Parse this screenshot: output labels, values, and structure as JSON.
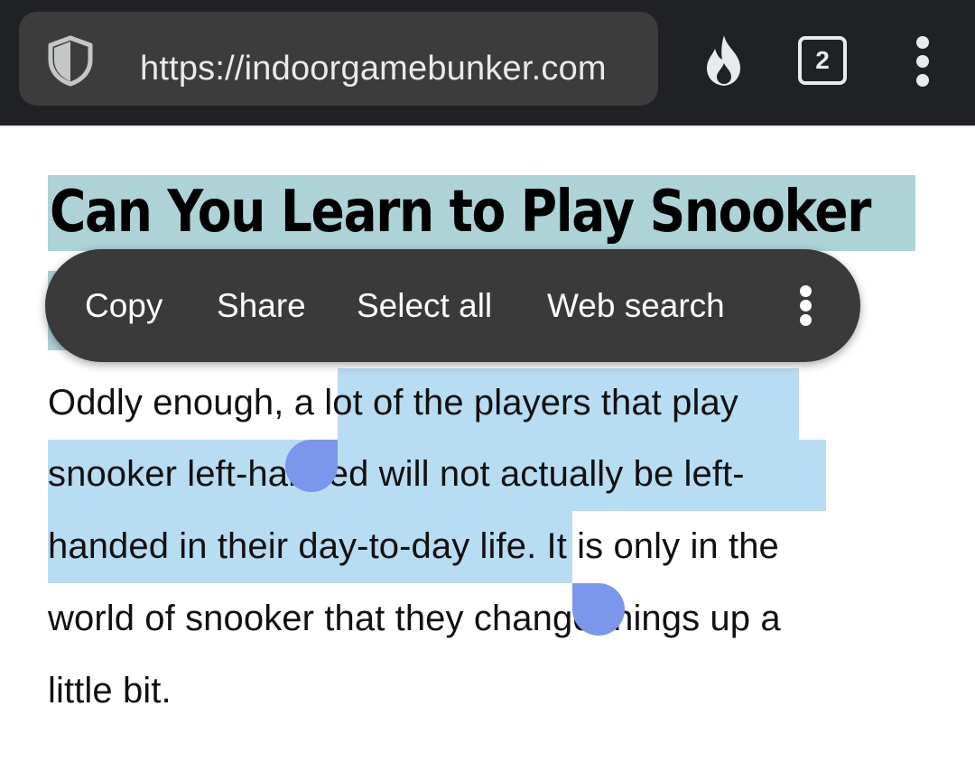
{
  "toolbar": {
    "url": "https://indoorgamebunker.com",
    "tab_count": "2",
    "icons": {
      "security": "shield-icon",
      "fire": "fire-icon",
      "menu": "more-vert-icon"
    }
  },
  "article": {
    "title_visible": "Can You Learn to Play Snooker",
    "paragraph_lines": [
      "Oddly enough, a lot of the players that play",
      "snooker left-handed will not actually be left-",
      "handed in their day-to-day life. It is only in the",
      "world of snooker that they change things up a",
      "little bit."
    ]
  },
  "context_menu": {
    "items": [
      "Copy",
      "Share",
      "Select all",
      "Web search"
    ],
    "more_icon": "more-vert-icon"
  },
  "colors": {
    "toolbar_bg": "#202124",
    "url_bar_bg": "#3c3c3c",
    "title_highlight": "#add3d7",
    "selection_highlight": "#b8dcf2",
    "selection_handle": "#7b96ea",
    "context_menu_bg": "#3a3a3a"
  }
}
